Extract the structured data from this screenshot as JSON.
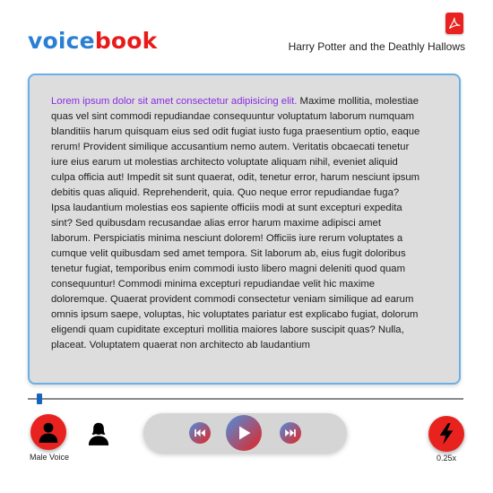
{
  "header": {
    "logo_part1": "voice",
    "logo_part2": "book",
    "book_title": "Harry Potter and the Deathly Hallows",
    "pdf_icon": "pdf-icon"
  },
  "reader": {
    "highlighted_text": "Lorem ipsum dolor sit amet consectetur adipisicing elit.",
    "body_text": " Maxime mollitia, molestiae quas vel sint commodi repudiandae consequuntur voluptatum laborum numquam blanditiis harum quisquam eius sed odit fugiat iusto fuga praesentium optio, eaque rerum! Provident similique accusantium nemo autem. Veritatis obcaecati tenetur iure eius earum ut molestias architecto voluptate aliquam nihil, eveniet aliquid culpa officia aut! Impedit sit sunt quaerat, odit, tenetur error, harum nesciunt ipsum debitis quas aliquid. Reprehenderit, quia. Quo neque error repudiandae fuga? Ipsa laudantium molestias eos sapiente officiis modi at sunt excepturi expedita sint? Sed quibusdam recusandae alias error harum maxime adipisci amet laborum. Perspiciatis minima nesciunt dolorem! Officiis iure rerum voluptates a cumque velit quibusdam sed amet tempora. Sit laborum ab, eius fugit doloribus tenetur fugiat, temporibus enim commodi iusto libero magni deleniti quod quam consequuntur! Commodi minima excepturi repudiandae velit hic maxime doloremque. Quaerat provident commodi consectetur veniam similique ad earum omnis ipsum saepe, voluptas, hic voluptates pariatur est explicabo fugiat, dolorum eligendi quam cupiditate excepturi mollitia maiores labore suscipit quas? Nulla, placeat. Voluptatem quaerat non architecto ab laudantium"
  },
  "playback": {
    "progress_fraction": 0.02,
    "voice_label": "Male Voice",
    "speed_label": "0.25x",
    "icons": [
      "male-voice-icon",
      "female-voice-icon",
      "rewind-icon",
      "play-icon",
      "fast-forward-icon",
      "speed-icon"
    ]
  },
  "colors": {
    "brand_blue": "#2a7fd4",
    "brand_red": "#e81b1b",
    "highlight": "#8a2be2",
    "panel_border": "#6ab0e6",
    "progress_thumb": "#1565c0"
  }
}
